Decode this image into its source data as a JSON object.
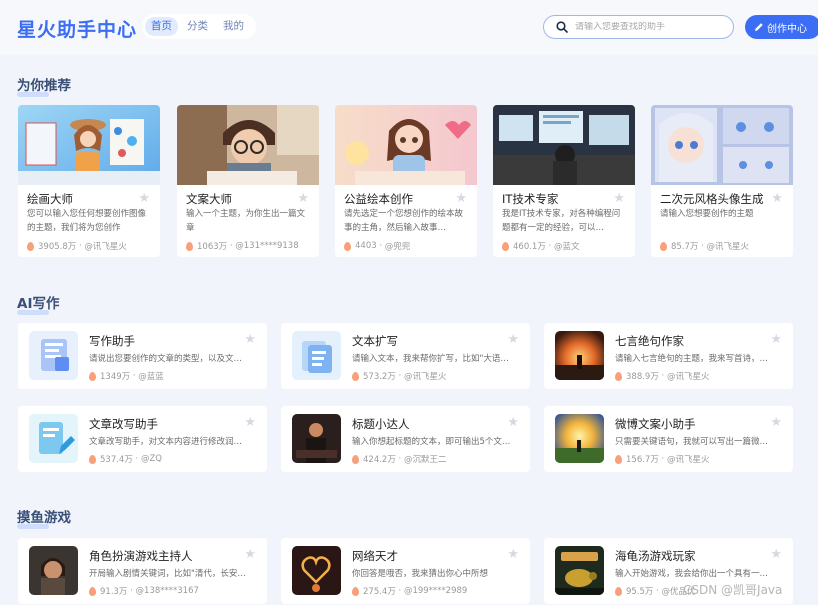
{
  "header": {
    "logo": "星火助手中心",
    "tabs": [
      {
        "label": "首页",
        "active": true
      },
      {
        "label": "分类",
        "active": false
      },
      {
        "label": "我的",
        "active": false
      }
    ],
    "search_placeholder": "请输入您要查找的助手",
    "create_label": "创作中心",
    "accent": "#3b6ef5"
  },
  "sections": {
    "recommend": {
      "title": "为你推荐",
      "cards": [
        {
          "name": "绘画大师",
          "desc": "您可以输入您任何想要创作图像的主题，我们将为您创作",
          "uses": "3905.8万",
          "author": "@讯飞星火"
        },
        {
          "name": "文案大师",
          "desc": "输入一个主题，为你生出一篇文章",
          "uses": "1063万",
          "author": "@131****9138"
        },
        {
          "name": "公益绘本创作",
          "desc": "请先选定一个您想创作的绘本故事的主角，然后输入故事…",
          "uses": "4403",
          "author": "@兜兜"
        },
        {
          "name": "IT技术专家",
          "desc": "我是IT技术专家，对各种编程问题都有一定的经验，可以…",
          "uses": "460.1万",
          "author": "@蓝文"
        },
        {
          "name": "二次元风格头像生成",
          "desc": "请输入您想要创作的主题",
          "uses": "85.7万",
          "author": "@讯飞星火"
        }
      ]
    },
    "ai_writing": {
      "title": "AI写作",
      "items": [
        {
          "name": "写作助手",
          "desc": "请说出您要创作的文章的类型，以及文…",
          "uses": "1349万",
          "author": "@蓝蓝"
        },
        {
          "name": "文本扩写",
          "desc": "请输入文本，我来帮你扩写，比如\"大语…",
          "uses": "573.2万",
          "author": "@讯飞星火"
        },
        {
          "name": "七言绝句作家",
          "desc": "请输入七言绝句的主题，我来写首诗，…",
          "uses": "388.9万",
          "author": "@讯飞星火"
        },
        {
          "name": "文章改写助手",
          "desc": "文章改写助手，对文本内容进行修改润…",
          "uses": "537.4万",
          "author": "@ZQ"
        },
        {
          "name": "标题小达人",
          "desc": "输入你想起标题的文本，即可输出5个文…",
          "uses": "424.2万",
          "author": "@沉默王二"
        },
        {
          "name": "微博文案小助手",
          "desc": "只需要关键语句，我就可以写出一篇微…",
          "uses": "156.7万",
          "author": "@讯飞星火"
        }
      ]
    },
    "games": {
      "title": "摸鱼游戏",
      "items": [
        {
          "name": "角色扮演游戏主持人",
          "desc": "开局输入剧情关键词，比如\"清代，长安…",
          "uses": "91.3万",
          "author": "@138****3167"
        },
        {
          "name": "网络天才",
          "desc": "你回答是哦否，我来猜出你心中所想",
          "uses": "275.4万",
          "author": "@199****2989"
        },
        {
          "name": "海龟汤游戏玩家",
          "desc": "输入开始游戏，我会给你出一个具有一…",
          "uses": "95.5万",
          "author": "@优品优"
        }
      ]
    }
  },
  "watermark": "CSDN @凯哥Java"
}
